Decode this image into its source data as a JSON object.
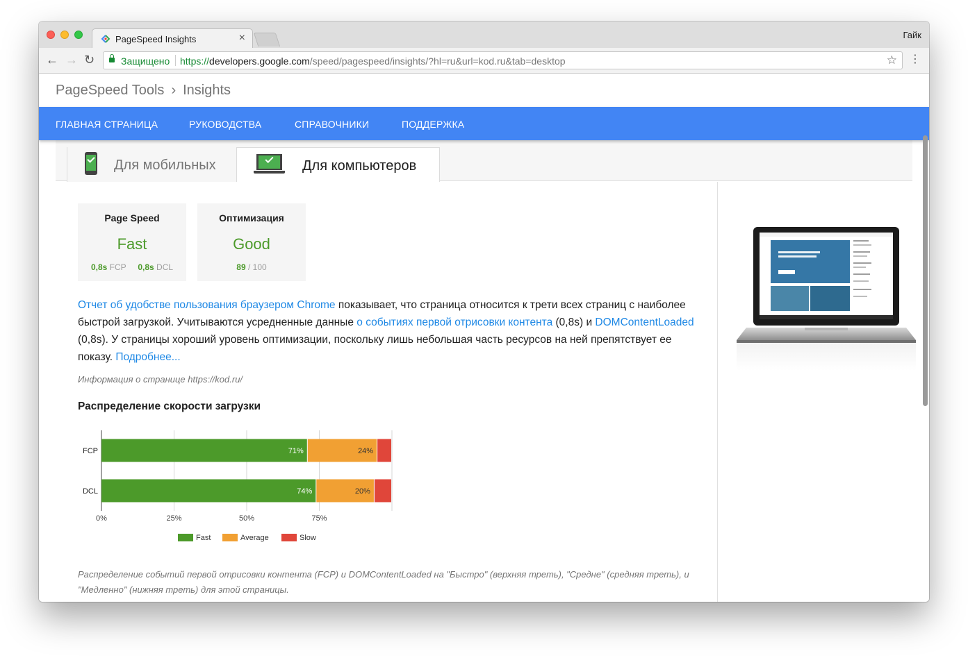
{
  "browser": {
    "tab_title": "PageSpeed Insights",
    "tab_close": "×",
    "profile": "Гайк",
    "nav": {
      "back": "←",
      "forward": "→",
      "reload": "↻"
    },
    "secure_label": "Защищено",
    "url_https": "https://",
    "url_host": "developers.google.com",
    "url_path": "/speed/pagespeed/insights/?hl=ru&url=kod.ru&tab=desktop",
    "star": "☆",
    "menu": "⋮"
  },
  "header": {
    "crumb_root": "PageSpeed Tools",
    "crumb_sep": "›",
    "crumb_current": "Insights"
  },
  "nav": {
    "items": [
      "ГЛАВНАЯ СТРАНИЦА",
      "РУКОВОДСТВА",
      "СПРАВОЧНИКИ",
      "ПОДДЕРЖКА"
    ]
  },
  "device_tabs": {
    "mobile": "Для мобильных",
    "desktop": "Для компьютеров"
  },
  "cards": {
    "speed": {
      "title": "Page Speed",
      "value": "Fast",
      "fcp_value": "0,8s",
      "fcp_label": "FCP",
      "dcl_value": "0,8s",
      "dcl_label": "DCL"
    },
    "optimization": {
      "title": "Оптимизация",
      "value": "Good",
      "score": "89",
      "score_max": "/ 100"
    }
  },
  "description": {
    "link1": "Отчет об удобстве пользования браузером Chrome",
    "t1": " показывает, что страница относится к трети всех страниц с наиболее быстрой загрузкой. Учитываются усредненные данные ",
    "link2": "о событиях первой отрисовки контента",
    "t2": " (0,8s) и ",
    "link3": "DOMContentLoaded",
    "t3": " (0,8s). У страницы хороший уровень оптимизации, поскольку лишь небольшая часть ресурсов на ней препятствует ее показу. ",
    "link4": "Подробнее..."
  },
  "page_info": "Информация о странице https://kod.ru/",
  "distribution_title": "Распределение скорости загрузки",
  "chart_data": {
    "type": "bar",
    "orientation": "horizontal",
    "stacked": true,
    "categories": [
      "FCP",
      "DCL"
    ],
    "series": [
      {
        "name": "Fast",
        "color": "#4c9a2a",
        "values": [
          71,
          74
        ],
        "labels": [
          "71%",
          "74%"
        ]
      },
      {
        "name": "Average",
        "color": "#f1a033",
        "values": [
          24,
          20
        ],
        "labels": [
          "24%",
          "20%"
        ]
      },
      {
        "name": "Slow",
        "color": "#e0463a",
        "values": [
          5,
          6
        ],
        "labels": [
          "",
          ""
        ]
      }
    ],
    "xlim": [
      0,
      100
    ],
    "xticks": [
      0,
      25,
      50,
      75,
      100
    ],
    "xtick_labels": [
      "0%",
      "25%",
      "50%",
      "75%",
      ""
    ],
    "grid": true,
    "legend": "bottom"
  },
  "footnote": "Распределение событий первой отрисовки контента (FCP) и DOMContentLoaded на \"Быстро\" (верхняя треть), \"Средне\" (средняя треть), и \"Медленно\" (нижняя треть) для этой страницы.",
  "colors": {
    "nav_blue": "#4285f4",
    "green": "#4c9a2a",
    "link": "#1e88e5"
  },
  "icons": {
    "mobile": "phone-check-icon",
    "desktop": "monitor-check-icon"
  }
}
